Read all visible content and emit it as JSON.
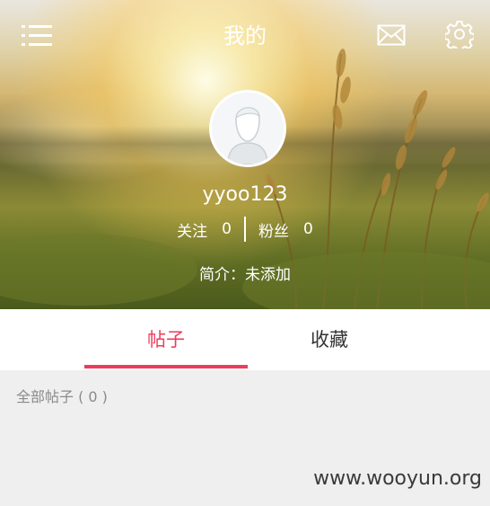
{
  "page": {
    "title": "我的"
  },
  "topbar": {
    "menu_icon": "menu-icon",
    "mail_icon": "mail-icon",
    "settings_icon": "gear-icon"
  },
  "profile": {
    "username": "yyoo123",
    "following_label": "关注",
    "following_count": "0",
    "followers_label": "粉丝",
    "followers_count": "0",
    "bio": "简介：未添加"
  },
  "tabs": [
    {
      "label": "帖子",
      "active": true
    },
    {
      "label": "收藏",
      "active": false
    }
  ],
  "content": {
    "posts_count_label": "全部帖子 ( 0 )"
  },
  "watermark": "www.wooyun.org",
  "colors": {
    "accent": "#ec3d5c",
    "tab_text": "#333333",
    "muted_text": "#8a8a8a"
  }
}
